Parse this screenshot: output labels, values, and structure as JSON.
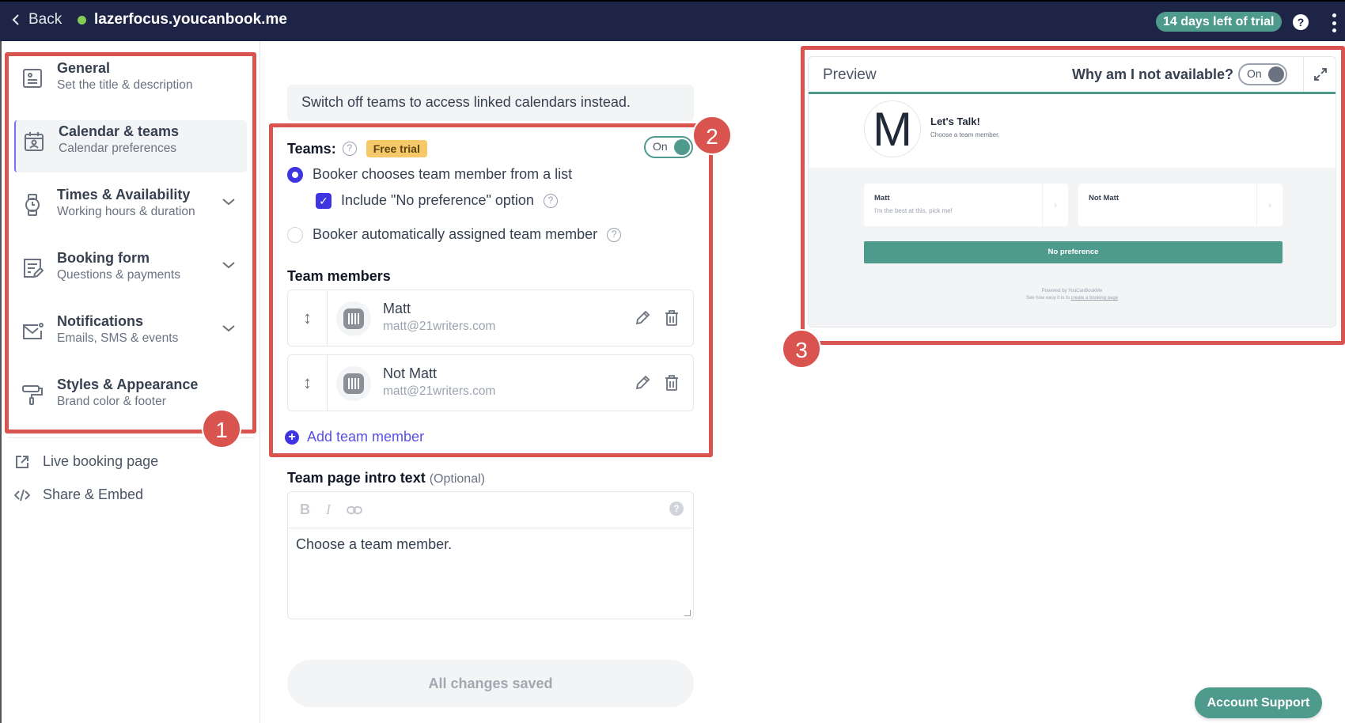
{
  "topbar": {
    "back_label": "Back",
    "site_name": "lazerfocus.youcanbook.me",
    "site_status_color": "#84cc55",
    "trial_badge": "14 days left of trial",
    "help_icon": "?",
    "more_icon": "kebab-icon"
  },
  "sidebar": {
    "items": [
      {
        "title": "General",
        "subtitle": "Set the title & description",
        "icon": "id-card-icon",
        "expandable": false,
        "active": false
      },
      {
        "title": "Calendar & teams",
        "subtitle": "Calendar preferences",
        "icon": "calendar-user-icon",
        "expandable": false,
        "active": true
      },
      {
        "title": "Times & Availability",
        "subtitle": "Working hours & duration",
        "icon": "watch-icon",
        "expandable": true,
        "active": false
      },
      {
        "title": "Booking form",
        "subtitle": "Questions & payments",
        "icon": "form-edit-icon",
        "expandable": true,
        "active": false
      },
      {
        "title": "Notifications",
        "subtitle": "Emails, SMS & events",
        "icon": "mail-icon",
        "expandable": true,
        "active": false
      },
      {
        "title": "Styles & Appearance",
        "subtitle": "Brand color & footer",
        "icon": "paint-roller-icon",
        "expandable": false,
        "active": false
      }
    ],
    "links": [
      {
        "label": "Live booking page",
        "icon": "external-link-icon"
      },
      {
        "label": "Share & Embed",
        "icon": "code-icon"
      }
    ]
  },
  "annotations": [
    "1",
    "2",
    "3"
  ],
  "main": {
    "notice": "Switch off teams to access linked calendars instead.",
    "teams_label": "Teams:",
    "teams_badge": "Free trial",
    "teams_toggle": {
      "label": "On",
      "state": true
    },
    "options": {
      "list_choice": "Booker chooses team member from a list",
      "list_choice_selected": true,
      "no_preference": "Include \"No preference\" option",
      "no_preference_checked": true,
      "auto_assign": "Booker automatically assigned team member",
      "auto_assign_selected": false
    },
    "team_members_title": "Team members",
    "members": [
      {
        "name": "Matt",
        "email": "matt@21writers.com"
      },
      {
        "name": "Not Matt",
        "email": "matt@21writers.com"
      }
    ],
    "add_member_label": "Add team member",
    "intro_label": "Team page intro text",
    "intro_optional": "(Optional)",
    "intro_toolbar": {
      "bold": "B",
      "italic": "I",
      "help": "?"
    },
    "intro_text": "Choose a team member.",
    "save_status": "All changes saved"
  },
  "preview": {
    "title": "Preview",
    "why_label": "Why am I not available?",
    "why_toggle": {
      "label": "On",
      "state": true
    },
    "logo_letter": "M",
    "page_title": "Let's Talk!",
    "page_subtitle": "Choose a team member.",
    "cards": [
      {
        "name": "Matt",
        "description": "I'm the best at this, pick me!"
      },
      {
        "name": "Not Matt",
        "description": ""
      }
    ],
    "no_preference_label": "No preference",
    "powered_by": "Powered by YouCanBookMe",
    "footer_prefix": "See how easy it is to ",
    "footer_link": "create a booking page",
    "accent_color": "#4e9a8c"
  },
  "support_button": "Account Support"
}
